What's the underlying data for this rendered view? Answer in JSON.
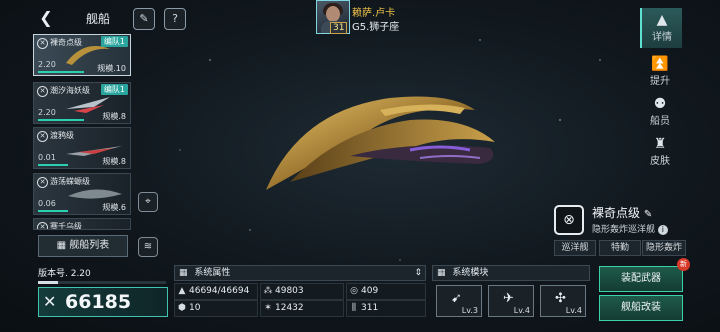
{
  "header": {
    "back_icon": "back-arrow-icon",
    "title": "舰船",
    "edit_icon": "brush-icon",
    "help_label": "?"
  },
  "player": {
    "name": "赖萨.卢卡",
    "level": "31",
    "location": "G5.狮子座"
  },
  "ship_list": [
    {
      "name": "裸奇点级",
      "fleet": "编队1",
      "value": "2.20",
      "scale": "规模.10",
      "selected": true
    },
    {
      "name": "潮汐海妖级",
      "fleet": "编队1",
      "value": "2.20",
      "scale": "规模.8",
      "selected": false
    },
    {
      "name": "渡鸦级",
      "fleet": "",
      "value": "0.01",
      "scale": "规模.8",
      "selected": false
    },
    {
      "name": "游荡蝾螈级",
      "fleet": "",
      "value": "0.06",
      "scale": "规模.6",
      "selected": false
    },
    {
      "name": "赛千乌级",
      "fleet": "",
      "value": "",
      "scale": "",
      "selected": false
    }
  ],
  "list_button": "舰船列表",
  "right_tabs": [
    {
      "label": "详情",
      "icon": "detail-icon",
      "active": true
    },
    {
      "label": "提升",
      "icon": "upgrade-icon",
      "active": false
    },
    {
      "label": "船员",
      "icon": "crew-icon",
      "active": false
    },
    {
      "label": "皮肤",
      "icon": "skin-icon",
      "active": false
    }
  ],
  "ship_info": {
    "name": "裸奇点级",
    "type": "隐形轰炸巡洋舰",
    "tags": [
      "巡洋舰",
      "特勤",
      "隐形轰炸"
    ]
  },
  "version": {
    "label": "版本号. 2.20",
    "power": "66185"
  },
  "attributes": {
    "title": "系统属性",
    "values": [
      "46694/46694",
      "49803",
      "409",
      "10",
      "12432",
      "311"
    ]
  },
  "modules": {
    "title": "系统模块",
    "slots": [
      {
        "icon": "missile-icon",
        "level": "Lv.3"
      },
      {
        "icon": "fighter-icon",
        "level": "Lv.4"
      },
      {
        "icon": "drone-icon",
        "level": "Lv.4"
      }
    ]
  },
  "actions": {
    "equip": "装配武器",
    "modify": "舰船改装",
    "new_badge": "新"
  }
}
